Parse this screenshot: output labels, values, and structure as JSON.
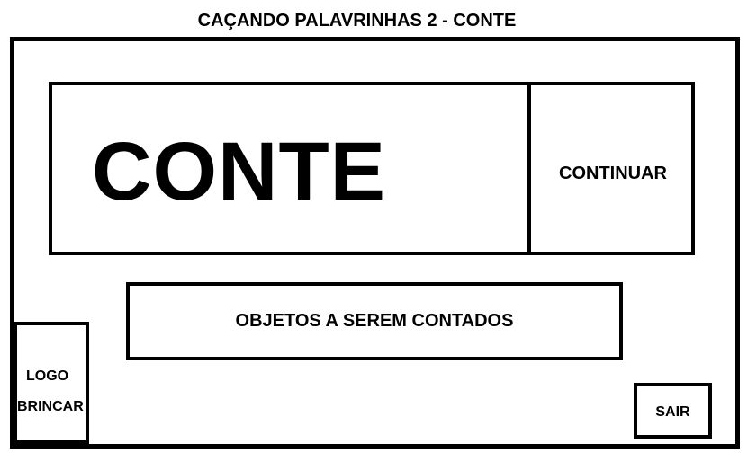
{
  "header": {
    "title": "CAÇANDO PALAVRINHAS 2 - CONTE"
  },
  "main": {
    "word": "CONTE",
    "continue_label": "CONTINUAR",
    "objects_label": "OBJETOS A SEREM CONTADOS"
  },
  "footer": {
    "logo_line1": "LOGO",
    "logo_line2": "BRINCAR",
    "exit_label": "SAIR"
  },
  "colors": {
    "border": "#000000",
    "background": "#ffffff",
    "text": "#000000"
  }
}
